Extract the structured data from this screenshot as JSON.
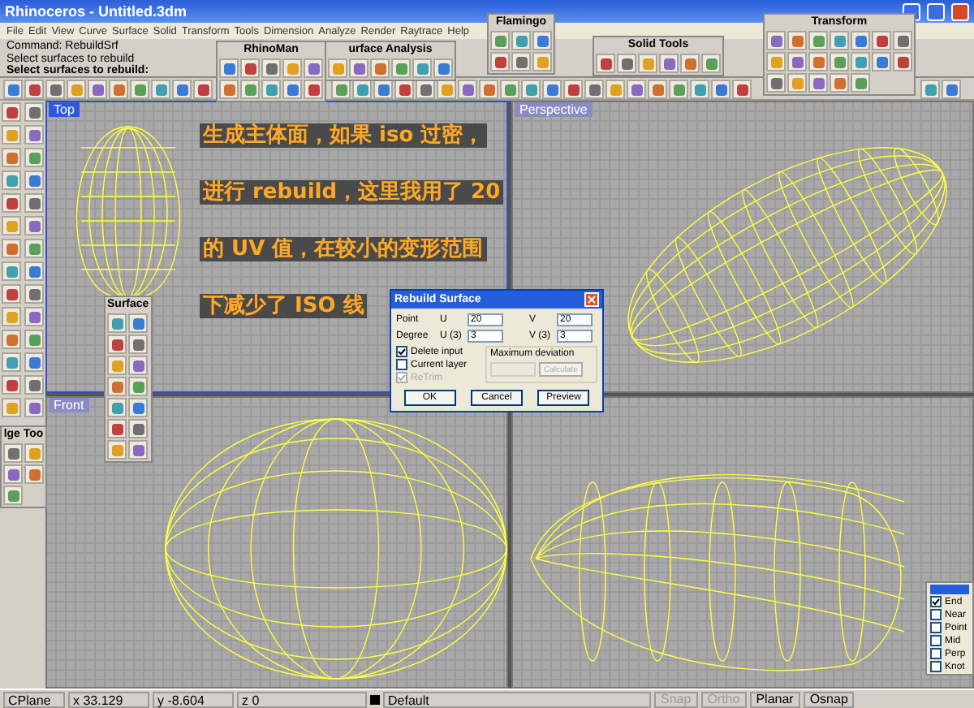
{
  "window": {
    "title": "Rhinoceros - Untitled.3dm"
  },
  "menu": [
    "File",
    "Edit",
    "View",
    "Curve",
    "Surface",
    "Solid",
    "Transform",
    "Tools",
    "Dimension",
    "Analyze",
    "Render",
    "Raytrace",
    "Help"
  ],
  "command_history": [
    "Command: RebuildSrf",
    "Select surfaces to rebuild"
  ],
  "command_prompt": "Select surfaces to rebuild:",
  "floating_toolbars": [
    {
      "title": "RhinoMan"
    },
    {
      "title": "urface Analysis"
    },
    {
      "title": "Flamingo"
    },
    {
      "title": "Solid Tools"
    },
    {
      "title": "Transform"
    },
    {
      "title": "Surface"
    },
    {
      "title": "lge Too"
    }
  ],
  "viewports": [
    {
      "label": "Top",
      "selected": true
    },
    {
      "label": "Perspective",
      "selected": false
    },
    {
      "label": "Front",
      "selected": false
    },
    {
      "selected": false
    }
  ],
  "annotation": [
    "生成主体面，如果 iso 过密，",
    "进行 rebuild，这里我用了 20",
    "的 UV 值，在较小的变形范围",
    "下减少了 ISO 线"
  ],
  "dialog": {
    "title": "Rebuild Surface",
    "point_label": "Point",
    "degree_label": "Degree",
    "point_u_label": "U",
    "point_v_label": "V",
    "degree_u_label": "U (3)",
    "degree_v_label": "V (3)",
    "point_u": "20",
    "point_v": "20",
    "degree_u": "3",
    "degree_v": "3",
    "options": [
      {
        "label": "Delete input",
        "checked": true,
        "disabled": false
      },
      {
        "label": "Current layer",
        "checked": false,
        "disabled": false
      },
      {
        "label": "ReTrim",
        "checked": true,
        "disabled": true
      }
    ],
    "deviation_label": "Maximum deviation",
    "calculate": {
      "label": "Calculate",
      "disabled": true
    },
    "buttons": [
      "OK",
      "Cancel",
      "Preview"
    ]
  },
  "osnap": [
    {
      "label": "End",
      "checked": true
    },
    {
      "label": "Near",
      "checked": false
    },
    {
      "label": "Point",
      "checked": false
    },
    {
      "label": "Mid",
      "checked": false
    },
    {
      "label": "Perp",
      "checked": false
    },
    {
      "label": "Knot",
      "checked": false
    }
  ],
  "status_bar": {
    "cplane": "CPlane",
    "x": "x 33.129",
    "y": "y -8.604",
    "z": "z 0",
    "layer": "Default",
    "toggles": [
      {
        "label": "Snap",
        "on": false
      },
      {
        "label": "Ortho",
        "on": false
      },
      {
        "label": "Planar",
        "on": true
      },
      {
        "label": "Osnap",
        "on": true
      }
    ]
  }
}
